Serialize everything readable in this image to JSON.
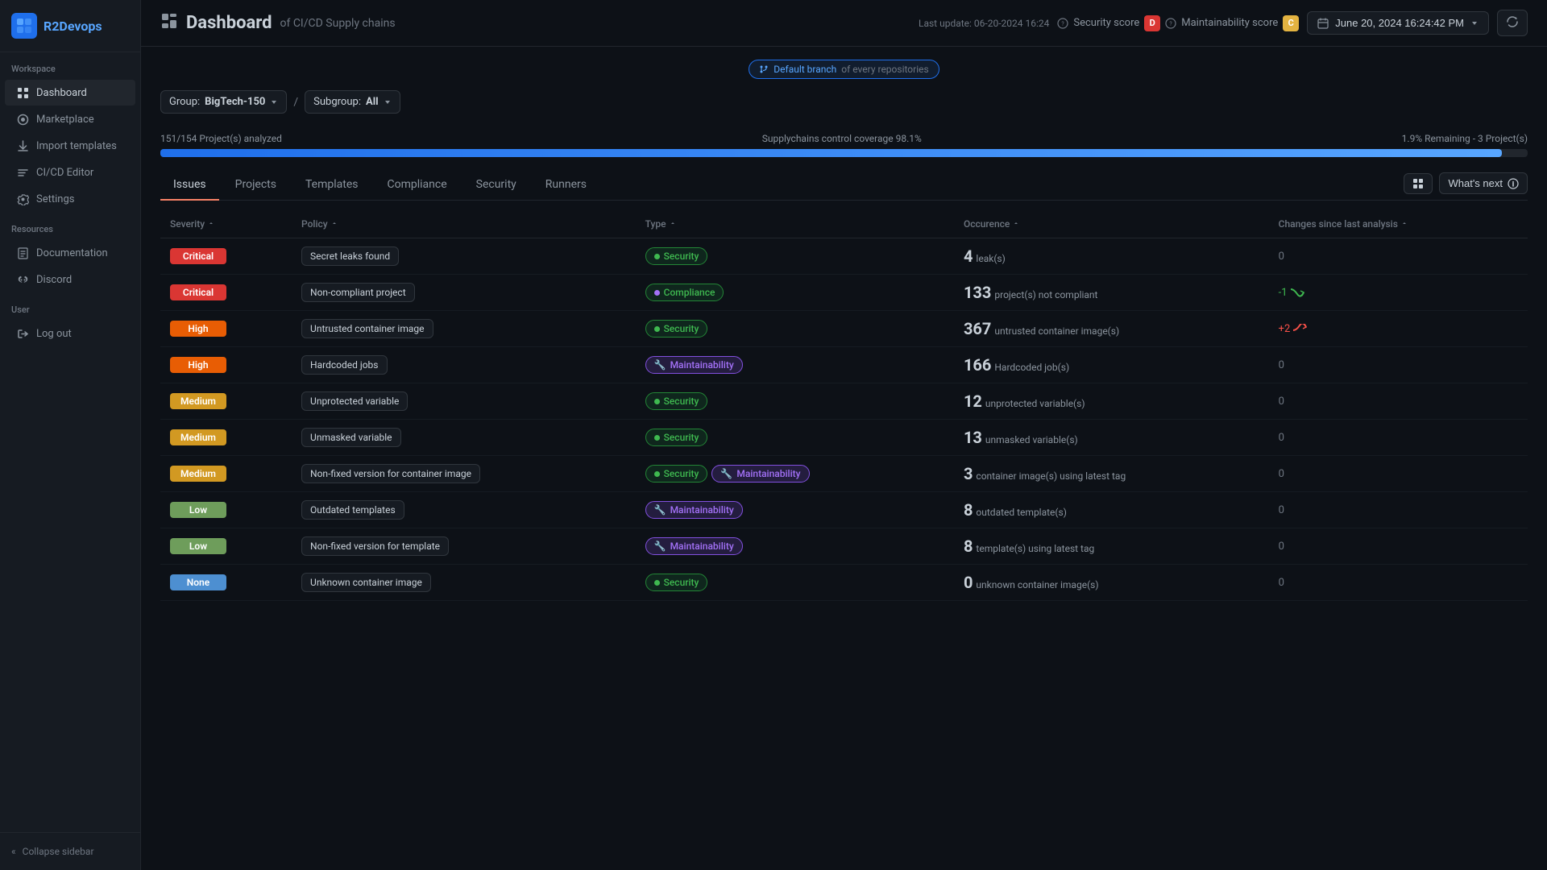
{
  "app": {
    "logo_icon": "R2",
    "logo_text": "R2Devops"
  },
  "sidebar": {
    "workspace_label": "Workspace",
    "items": [
      {
        "id": "dashboard",
        "label": "Dashboard",
        "icon": "⊞",
        "active": true
      },
      {
        "id": "marketplace",
        "label": "Marketplace",
        "icon": "◎"
      },
      {
        "id": "import-templates",
        "label": "Import templates",
        "icon": "⬇"
      },
      {
        "id": "cicd-editor",
        "label": "CI/CD Editor",
        "icon": "✎"
      },
      {
        "id": "settings",
        "label": "Settings",
        "icon": "⚙"
      }
    ],
    "resources_label": "Resources",
    "resources": [
      {
        "id": "documentation",
        "label": "Documentation",
        "icon": "📄"
      },
      {
        "id": "discord",
        "label": "Discord",
        "icon": "💬"
      }
    ],
    "user_label": "User",
    "user_items": [
      {
        "id": "log-out",
        "label": "Log out",
        "icon": "→"
      }
    ],
    "collapse_label": "Collapse sidebar"
  },
  "header": {
    "icon": "📊",
    "title": "Dashboard",
    "subtitle": "of CI/CD Supply chains",
    "last_update_label": "Last update: 06-20-2024 16:24",
    "date_value": "June 20, 2024 16:24:42 PM",
    "refresh_icon": "↻",
    "calendar_icon": "📋",
    "security_score_label": "Security score",
    "security_score_value": "D",
    "maintainability_score_label": "Maintainability score",
    "maintainability_score_value": "C"
  },
  "branch_banner": {
    "branch_icon": "⎇",
    "branch_label": "Default branch",
    "suffix": "of every repositories"
  },
  "filters": {
    "group_label": "Group:",
    "group_value": "BigTech-150",
    "separator": "/",
    "subgroup_label": "Subgroup:",
    "subgroup_value": "All"
  },
  "progress": {
    "analyzed_text": "151/154 Project(s) analyzed",
    "coverage_text": "Supplychains control coverage 98.1%",
    "remaining_text": "1.9% Remaining - 3 Project(s)",
    "fill_percent": 98.1
  },
  "tabs": {
    "items": [
      {
        "id": "issues",
        "label": "Issues",
        "active": true
      },
      {
        "id": "projects",
        "label": "Projects",
        "active": false
      },
      {
        "id": "templates",
        "label": "Templates",
        "active": false
      },
      {
        "id": "compliance",
        "label": "Compliance",
        "active": false
      },
      {
        "id": "security",
        "label": "Security",
        "active": false
      },
      {
        "id": "runners",
        "label": "Runners",
        "active": false
      }
    ],
    "view_btn": "☰",
    "whats_next_label": "What's next",
    "whats_next_icon": "ⓘ"
  },
  "table": {
    "columns": [
      {
        "id": "severity",
        "label": "Severity"
      },
      {
        "id": "policy",
        "label": "Policy"
      },
      {
        "id": "type",
        "label": "Type"
      },
      {
        "id": "occurrence",
        "label": "Occurence"
      },
      {
        "id": "changes",
        "label": "Changes since last analysis"
      }
    ],
    "rows": [
      {
        "severity": "Critical",
        "severity_class": "severity-critical",
        "policy": "Secret leaks found",
        "types": [
          {
            "label": "Security",
            "class": "type-security",
            "dot": true
          }
        ],
        "occurrence_count": "4",
        "occurrence_label": "leak(s)",
        "change_value": "0",
        "change_type": "neutral"
      },
      {
        "severity": "Critical",
        "severity_class": "severity-critical",
        "policy": "Non-compliant project",
        "types": [
          {
            "label": "Compliance",
            "class": "type-compliance",
            "dot": true
          }
        ],
        "occurrence_count": "133",
        "occurrence_label": "project(s) not compliant",
        "change_value": "-1",
        "change_type": "down",
        "change_icon": "↘"
      },
      {
        "severity": "High",
        "severity_class": "severity-high",
        "policy": "Untrusted container image",
        "types": [
          {
            "label": "Security",
            "class": "type-security",
            "dot": true
          }
        ],
        "occurrence_count": "367",
        "occurrence_label": "untrusted container image(s)",
        "change_value": "+2",
        "change_type": "up",
        "change_icon": "↗"
      },
      {
        "severity": "High",
        "severity_class": "severity-high",
        "policy": "Hardcoded jobs",
        "types": [
          {
            "label": "Maintainability",
            "class": "type-maintainability",
            "wrench": true
          }
        ],
        "occurrence_count": "166",
        "occurrence_label": "Hardcoded job(s)",
        "change_value": "0",
        "change_type": "neutral"
      },
      {
        "severity": "Medium",
        "severity_class": "severity-medium",
        "policy": "Unprotected variable",
        "types": [
          {
            "label": "Security",
            "class": "type-security",
            "dot": true
          }
        ],
        "occurrence_count": "12",
        "occurrence_label": "unprotected variable(s)",
        "change_value": "0",
        "change_type": "neutral"
      },
      {
        "severity": "Medium",
        "severity_class": "severity-medium",
        "policy": "Unmasked variable",
        "types": [
          {
            "label": "Security",
            "class": "type-security",
            "dot": true
          }
        ],
        "occurrence_count": "13",
        "occurrence_label": "unmasked variable(s)",
        "change_value": "0",
        "change_type": "neutral"
      },
      {
        "severity": "Medium",
        "severity_class": "severity-medium",
        "policy": "Non-fixed version for container image",
        "types": [
          {
            "label": "Security",
            "class": "type-security",
            "dot": true
          },
          {
            "label": "Maintainability",
            "class": "type-maintainability",
            "wrench": true
          }
        ],
        "occurrence_count": "3",
        "occurrence_label": "container image(s) using latest tag",
        "change_value": "0",
        "change_type": "neutral"
      },
      {
        "severity": "Low",
        "severity_class": "severity-low",
        "policy": "Outdated templates",
        "types": [
          {
            "label": "Maintainability",
            "class": "type-maintainability",
            "wrench": true
          }
        ],
        "occurrence_count": "8",
        "occurrence_label": "outdated template(s)",
        "change_value": "0",
        "change_type": "neutral"
      },
      {
        "severity": "Low",
        "severity_class": "severity-low",
        "policy": "Non-fixed version for template",
        "types": [
          {
            "label": "Maintainability",
            "class": "type-maintainability",
            "wrench": true
          }
        ],
        "occurrence_count": "8",
        "occurrence_label": "template(s) using latest tag",
        "change_value": "0",
        "change_type": "neutral"
      },
      {
        "severity": "None",
        "severity_class": "severity-none",
        "policy": "Unknown container image",
        "types": [
          {
            "label": "Security",
            "class": "type-security",
            "dot": true
          }
        ],
        "occurrence_count": "0",
        "occurrence_label": "unknown container image(s)",
        "change_value": "0",
        "change_type": "neutral"
      }
    ]
  }
}
